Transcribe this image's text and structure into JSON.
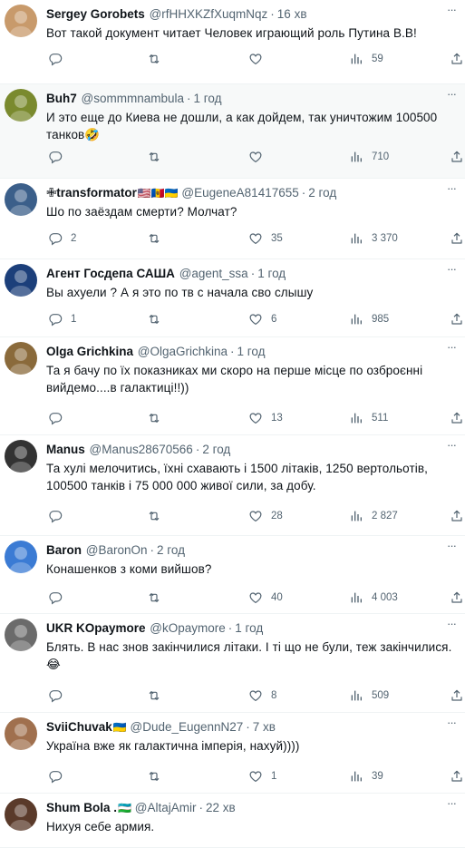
{
  "tweets": [
    {
      "name": "Sergey Gorobets",
      "flags": "",
      "handle": "@rfHHXKZfXuqmNqz",
      "time": "16 хв",
      "text": "Вот такой документ читает Человек играющий роль Путина В.В!",
      "replies": "",
      "retweets": "",
      "likes": "",
      "views": "59",
      "avatar_color": "#c89a6b"
    },
    {
      "name": "Buh7",
      "flags": "",
      "handle": "@sommmnambula",
      "time": "1 год",
      "text": "И это еще до Киева не дошли, а как дойдем, так уничтожим 100500 танков🤣",
      "replies": "",
      "retweets": "",
      "likes": "",
      "views": "710",
      "avatar_color": "#7a8a2e"
    },
    {
      "name": "✙transformator",
      "flags": "🇺🇸🇲🇩🇺🇦",
      "handle": "@EugeneA81417655",
      "time": "2 год",
      "text": "Шо по заёздам смерти? Молчат?",
      "replies": "2",
      "retweets": "",
      "likes": "35",
      "views": "3 370",
      "avatar_color": "#3b5f8a"
    },
    {
      "name": "Агент Госдепа САША",
      "flags": "",
      "handle": "@agent_ssa",
      "time": "1 год",
      "text": "Вы ахуели ? А я это по тв с начала сво слышу",
      "replies": "1",
      "retweets": "",
      "likes": "6",
      "views": "985",
      "avatar_color": "#1c3f7a"
    },
    {
      "name": "Olga Grichkina",
      "flags": "",
      "handle": "@OlgaGrichkina",
      "time": "1 год",
      "text": "Та я бачу по їх показниках ми скоро на перше місце по озброєнні вийдемо....в галактиці!!))",
      "replies": "",
      "retweets": "",
      "likes": "13",
      "views": "511",
      "avatar_color": "#8a6a3b"
    },
    {
      "name": "Manus",
      "flags": "",
      "handle": "@Manus28670566",
      "time": "2 год",
      "text": "Та хулі мелочитись, їхні схавають і 1500 літаків, 1250 вертольотів, 100500 танків і 75 000 000 живої сили, за добу.",
      "replies": "",
      "retweets": "",
      "likes": "28",
      "views": "2 827",
      "avatar_color": "#333333"
    },
    {
      "name": "Baron",
      "flags": "",
      "handle": "@BaronOn",
      "time": "2 год",
      "text": "Конашенков з коми вийшов?",
      "replies": "",
      "retweets": "",
      "likes": "40",
      "views": "4 003",
      "avatar_color": "#3b7bd4"
    },
    {
      "name": "UKR KOpaymore",
      "flags": "",
      "handle": "@kOpaymore",
      "time": "1 год",
      "text": "Блять. В нас знов закінчилися літаки. І ті що не були, теж закінчилися. 😂",
      "replies": "",
      "retweets": "",
      "likes": "8",
      "views": "509",
      "avatar_color": "#6b6b6b"
    },
    {
      "name": "SviiChuvak",
      "flags": "🇺🇦",
      "handle": "@Dude_EugennN27",
      "time": "7 хв",
      "text": "Україна вже як галактична імперія, нахуй))))",
      "replies": "",
      "retweets": "",
      "likes": "1",
      "views": "39",
      "avatar_color": "#a0704e"
    },
    {
      "name": "Shum Bola .",
      "flags": "🇺🇿",
      "handle": "@AltajAmir",
      "time": "22 хв",
      "text": "Нихуя себе армия.",
      "replies": "",
      "retweets": "",
      "likes": "",
      "views": "",
      "avatar_color": "#5a3a2a"
    }
  ]
}
